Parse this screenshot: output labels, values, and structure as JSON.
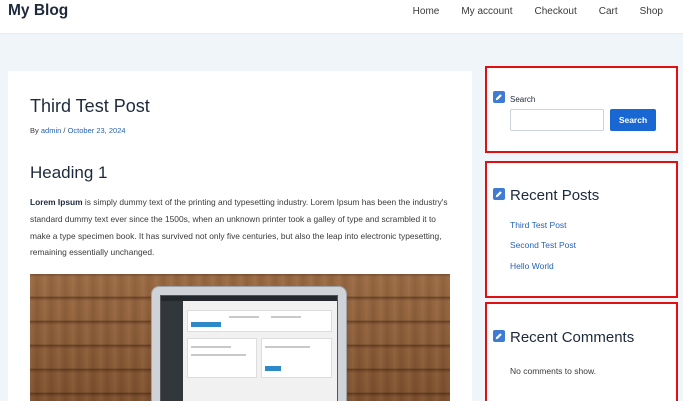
{
  "header": {
    "site_title": "My Blog",
    "nav": [
      "Home",
      "My account",
      "Checkout",
      "Cart",
      "Shop"
    ]
  },
  "post": {
    "title": "Third Test Post",
    "author": "admin",
    "date": "October 23, 2024",
    "meta_prefix": "By",
    "meta_sep": "/",
    "heading": "Heading 1",
    "lead_bold": "Lorem Ipsum",
    "body": " is simply dummy text of the printing and typesetting industry. Lorem Ipsum has been the industry's standard dummy text ever since the 1500s, when an unknown printer took a galley of type and scrambled it to make a type specimen book. It has survived not only five centuries, but also the leap into electronic typesetting, remaining essentially unchanged."
  },
  "sidebar": {
    "search": {
      "label": "Search",
      "placeholder": "",
      "value": "",
      "button": "Search"
    },
    "recent_posts": {
      "title": "Recent Posts",
      "items": [
        "Third Test Post",
        "Second Test Post",
        "Hello World"
      ]
    },
    "recent_comments": {
      "title": "Recent Comments",
      "empty": "No comments to show."
    }
  },
  "colors": {
    "link": "#2563b5",
    "button": "#1967d2",
    "highlight_border": "#e01010",
    "edit_icon": "#3f7bd2",
    "page_bg": "#f0f5fa"
  },
  "icons": {
    "widget_edit": "pencil-edit-icon"
  }
}
